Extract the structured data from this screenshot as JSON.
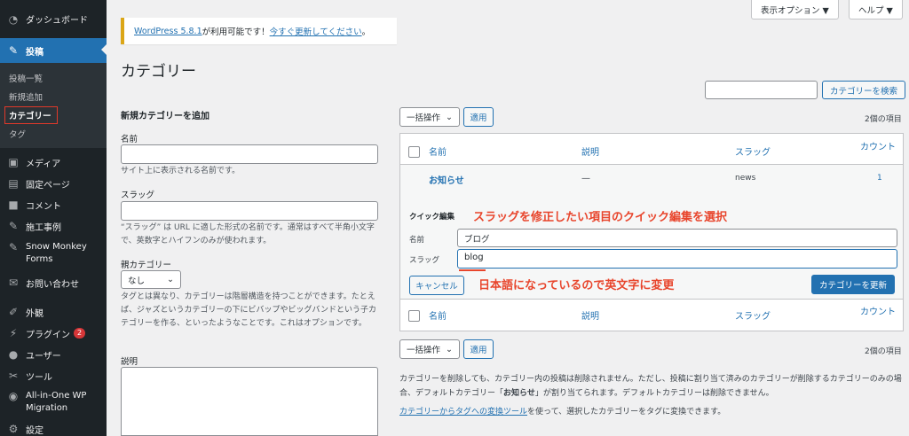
{
  "sidebar": {
    "items_top": [
      {
        "label": "ダッシュボード",
        "icon": "dashboard-icon",
        "glyph": "◔"
      }
    ],
    "posts": {
      "label": "投稿",
      "icon": "pin-icon",
      "glyph": "✎"
    },
    "submenu": [
      {
        "label": "投稿一覧"
      },
      {
        "label": "新規追加"
      },
      {
        "label": "カテゴリー"
      },
      {
        "label": "タグ"
      }
    ],
    "items": [
      {
        "label": "メディア",
        "icon": "media-icon",
        "glyph": "▣"
      },
      {
        "label": "固定ページ",
        "icon": "page-icon",
        "glyph": "▤"
      },
      {
        "label": "コメント",
        "icon": "comment-icon",
        "glyph": "■"
      },
      {
        "label": "施工事例",
        "icon": "pin-icon",
        "glyph": "✎"
      },
      {
        "label": "Snow Monkey Forms",
        "icon": "pin-icon",
        "glyph": "✎"
      },
      {
        "label": "お問い合わせ",
        "icon": "mail-icon",
        "glyph": "✉"
      },
      {
        "label": "外観",
        "icon": "brush-icon",
        "glyph": "✐"
      },
      {
        "label": "プラグイン",
        "icon": "plugin-icon",
        "glyph": "⚡",
        "badge": "2"
      },
      {
        "label": "ユーザー",
        "icon": "user-icon",
        "glyph": "●"
      },
      {
        "label": "ツール",
        "icon": "tool-icon",
        "glyph": "✂"
      },
      {
        "label": "All-in-One WP Migration",
        "icon": "migration-icon",
        "glyph": "◉"
      },
      {
        "label": "設定",
        "icon": "settings-icon",
        "glyph": "⚙"
      }
    ]
  },
  "top": {
    "screen_options": "表示オプション ▼",
    "help": "ヘルプ ▼"
  },
  "notice": {
    "link1": "WordPress 5.8.1",
    "text": " が利用可能です！",
    "link2": "今すぐ更新してください",
    "end": "。"
  },
  "page_title": "カテゴリー",
  "form": {
    "title": "新規カテゴリーを追加",
    "name_label": "名前",
    "name_desc": "サイト上に表示される名前です。",
    "slug_label": "スラッグ",
    "slug_desc": "“スラッグ” は URL に適した形式の名前です。通常はすべて半角小文字で、英数字とハイフンのみが使われます。",
    "parent_label": "親カテゴリー",
    "parent_value": "なし",
    "parent_desc": "タグとは異なり、カテゴリーは階層構造を持つことができます。たとえば、ジャズというカテゴリーの下にビバップやビッグバンドという子カテゴリーを作る、といったようなことです。これはオプションです。",
    "desc_label": "説明"
  },
  "search": {
    "button": "カテゴリーを検索"
  },
  "bulk": {
    "select": "一括操作",
    "apply": "適用",
    "count": "2個の項目"
  },
  "table": {
    "headers": [
      "名前",
      "説明",
      "スラッグ",
      "カウント"
    ],
    "row": {
      "name": "お知らせ",
      "desc": "—",
      "slug": "news",
      "count": "1"
    },
    "quick_edit": {
      "title": "クイック編集",
      "name_label": "名前",
      "name_value": "ブログ",
      "slug_label": "スラッグ",
      "slug_value": "blog",
      "cancel": "キャンセル",
      "update": "カテゴリーを更新"
    }
  },
  "annotations": {
    "a1": "スラッグを修正したい項目のクイック編集を選択",
    "a2": "日本語になっているので英文字に変更"
  },
  "footer": {
    "p1_a": "カテゴリーを削除しても、カテゴリー内の投稿は削除されません。ただし、投稿に割り当て済みのカテゴリーが削除するカテゴリーのみの場合、デフォルトカテゴリー「",
    "p1_b": "お知らせ",
    "p1_c": "」が割り当てられます。デフォルトカテゴリーは削除できません。",
    "p2_link": "カテゴリーからタグへの変換ツール",
    "p2_text": "を使って、選択したカテゴリーをタグに変換できます。"
  },
  "colors": {
    "accent": "#2271b1",
    "annotation": "#e8452c",
    "sidebar": "#1d2327"
  }
}
